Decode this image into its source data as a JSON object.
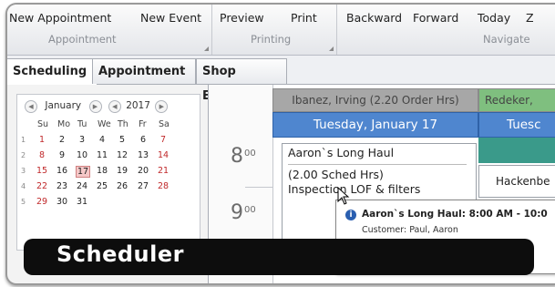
{
  "ribbon": {
    "groups": [
      {
        "buttons": [
          "New Appointment",
          "New Event"
        ],
        "label": "Appointment"
      },
      {
        "buttons": [
          "Preview",
          "Print"
        ],
        "label": "Printing"
      },
      {
        "buttons": [
          "Backward",
          "Forward",
          "Today",
          "Z"
        ],
        "label": "Navigate"
      }
    ]
  },
  "tabs": [
    "Scheduling",
    "Appointment",
    "Shop Events"
  ],
  "active_tab": "Scheduling",
  "calendar": {
    "month": "January",
    "year": "2017",
    "weekdays": [
      "Su",
      "Mo",
      "Tu",
      "We",
      "Th",
      "Fr",
      "Sa"
    ],
    "week_numbers": [
      "1",
      "2",
      "3",
      "4",
      "5"
    ],
    "weeks": [
      [
        "1",
        "2",
        "3",
        "4",
        "5",
        "6",
        "7"
      ],
      [
        "8",
        "9",
        "10",
        "11",
        "12",
        "13",
        "14"
      ],
      [
        "15",
        "16",
        "17",
        "18",
        "19",
        "20",
        "21"
      ],
      [
        "22",
        "23",
        "24",
        "25",
        "26",
        "27",
        "28"
      ],
      [
        "29",
        "30",
        "31",
        "",
        "",
        "",
        ""
      ]
    ],
    "selected_day": "17"
  },
  "schedule": {
    "hours": [
      "8",
      "9"
    ],
    "minutes": "00",
    "resources": [
      "Ibanez, Irving (2.20 Order Hrs)",
      "Redeker,"
    ],
    "day_headers": [
      "Tuesday, January 17",
      "Tuesc"
    ],
    "appointment": {
      "title": "Aaron`s Long Haul",
      "hours": "(2.00 Sched Hrs)",
      "service": "Inspection LOF & filters"
    },
    "other_appointment": "Hackenbe",
    "tooltip": {
      "title": "Aaron`s Long Haul: 8:00 AM - 10:0",
      "customer": "Customer: Paul, Aaron"
    }
  },
  "banner": {
    "title": "Scheduler"
  },
  "colors": {
    "day_header_blue": "#4f86cf",
    "resource_gray": "#a7a7a7",
    "resource_green": "#7fbf7f",
    "banner_black": "#0d0d0d",
    "weekend_red": "#c0282a"
  }
}
